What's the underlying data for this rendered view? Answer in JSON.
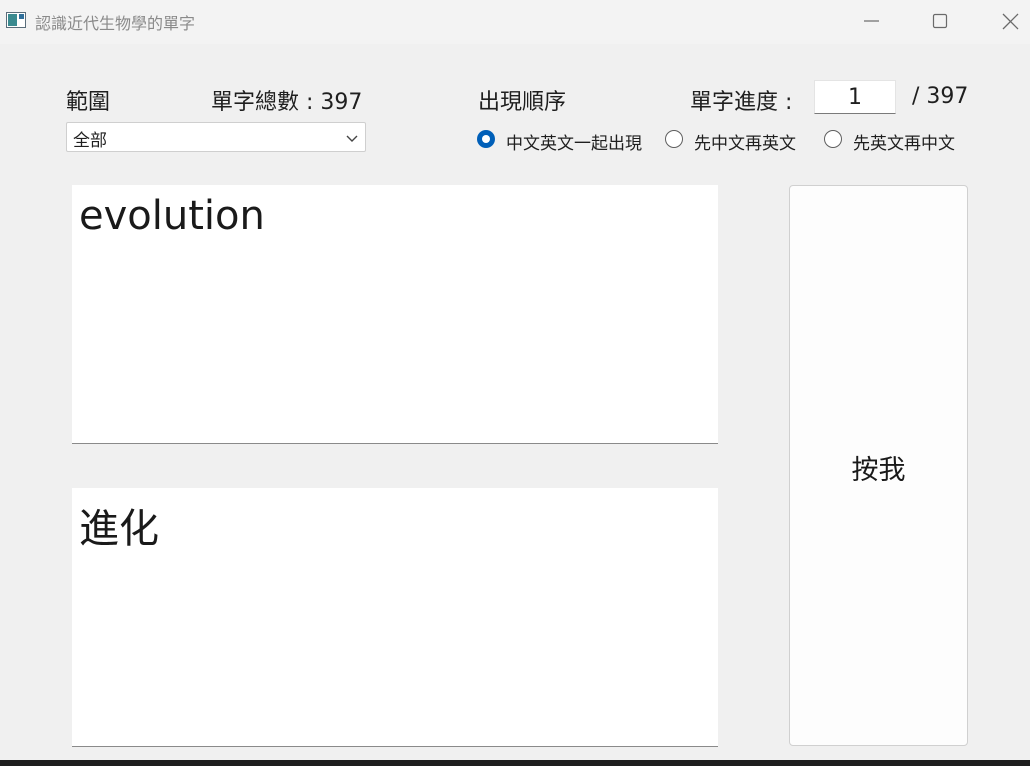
{
  "window": {
    "title": "認識近代生物學的單字"
  },
  "icons": {
    "app": "app-window-icon",
    "minimize": "minimize-icon",
    "maximize": "maximize-icon",
    "close": "close-icon",
    "dropdown": "chevron-down-icon"
  },
  "range": {
    "label": "範圍",
    "selected": "全部"
  },
  "total": {
    "label": "單字總數 : 397"
  },
  "order": {
    "label": "出現順序",
    "options": [
      {
        "label": "中文英文一起出現",
        "checked": true
      },
      {
        "label": "先中文再英文",
        "checked": false
      },
      {
        "label": "先英文再中文",
        "checked": false
      }
    ]
  },
  "progress": {
    "label": "單字進度 :",
    "current": "1",
    "total": "/ 397"
  },
  "display": {
    "english": "evolution",
    "chinese": "進化"
  },
  "button": {
    "label": "按我"
  },
  "colors": {
    "accent": "#005fb8",
    "window_bg": "#f0f0f0"
  }
}
